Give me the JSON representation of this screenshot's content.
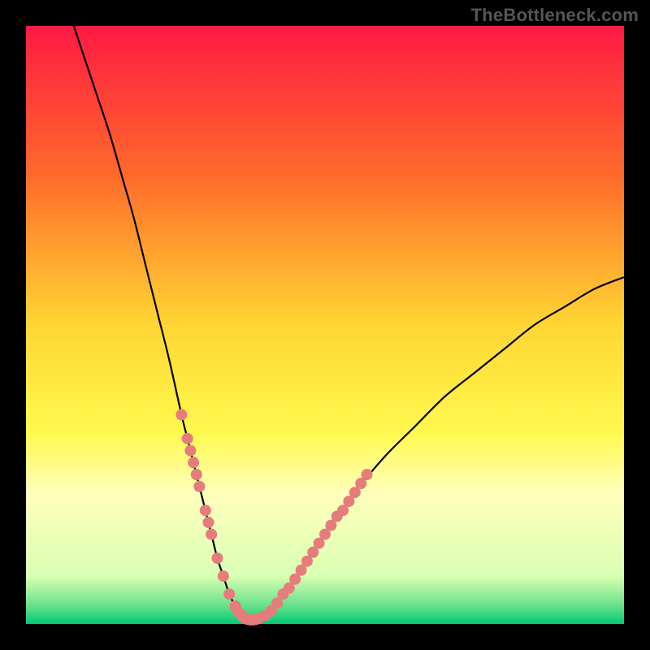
{
  "watermark": "TheBottleneck.com",
  "colors": {
    "frame": "#000000",
    "curve": "#000000",
    "marker": "#e77c7c"
  },
  "chart_data": {
    "type": "line",
    "title": "",
    "xlabel": "",
    "ylabel": "",
    "xlim": [
      0,
      100
    ],
    "ylim": [
      0,
      100
    ],
    "gradient": [
      {
        "stop": 0,
        "color": "#ff1a44"
      },
      {
        "stop": 0.25,
        "color": "#ff6a2a"
      },
      {
        "stop": 0.5,
        "color": "#ffd633"
      },
      {
        "stop": 0.68,
        "color": "#fff94d"
      },
      {
        "stop": 0.78,
        "color": "#ffffbb"
      },
      {
        "stop": 0.92,
        "color": "#d9ffb3"
      },
      {
        "stop": 0.97,
        "color": "#66e08c"
      },
      {
        "stop": 1.0,
        "color": "#00c977"
      }
    ],
    "series": [
      {
        "name": "bottleneck-curve",
        "x": [
          8,
          10,
          12,
          14,
          16,
          18,
          20,
          22,
          24,
          26,
          27,
          28,
          29,
          30,
          31,
          32,
          33,
          34,
          35,
          36,
          37,
          38,
          40,
          42,
          44,
          46,
          48,
          50,
          55,
          60,
          65,
          70,
          75,
          80,
          85,
          90,
          95,
          100
        ],
        "y": [
          100,
          94,
          88,
          82,
          75,
          68,
          60,
          52,
          44,
          35,
          31,
          27,
          23,
          19,
          15,
          11,
          8,
          5,
          3,
          1.5,
          0.7,
          0.7,
          1.4,
          3.5,
          6,
          9,
          12,
          15,
          22,
          28,
          33,
          38,
          42,
          46,
          50,
          53,
          56,
          58
        ]
      }
    ],
    "markers": {
      "name": "highlighted-dots",
      "color": "#e77c7c",
      "radius": 7,
      "points": [
        {
          "x": 26,
          "y": 35
        },
        {
          "x": 27,
          "y": 31
        },
        {
          "x": 27.5,
          "y": 29
        },
        {
          "x": 28,
          "y": 27
        },
        {
          "x": 28.5,
          "y": 25
        },
        {
          "x": 29,
          "y": 23
        },
        {
          "x": 30,
          "y": 19
        },
        {
          "x": 30.5,
          "y": 17
        },
        {
          "x": 31,
          "y": 15
        },
        {
          "x": 32,
          "y": 11
        },
        {
          "x": 33,
          "y": 8
        },
        {
          "x": 34,
          "y": 5
        },
        {
          "x": 35,
          "y": 3
        },
        {
          "x": 35.5,
          "y": 2
        },
        {
          "x": 36,
          "y": 1.5
        },
        {
          "x": 36.5,
          "y": 1
        },
        {
          "x": 37,
          "y": 0.8
        },
        {
          "x": 37.5,
          "y": 0.7
        },
        {
          "x": 38,
          "y": 0.7
        },
        {
          "x": 38.5,
          "y": 0.8
        },
        {
          "x": 39,
          "y": 1
        },
        {
          "x": 40,
          "y": 1.4
        },
        {
          "x": 41,
          "y": 2.2
        },
        {
          "x": 42,
          "y": 3.5
        },
        {
          "x": 43,
          "y": 5
        },
        {
          "x": 44,
          "y": 6
        },
        {
          "x": 45,
          "y": 7.5
        },
        {
          "x": 46,
          "y": 9
        },
        {
          "x": 47,
          "y": 10.5
        },
        {
          "x": 48,
          "y": 12
        },
        {
          "x": 49,
          "y": 13.5
        },
        {
          "x": 50,
          "y": 15
        },
        {
          "x": 51,
          "y": 16.5
        },
        {
          "x": 52,
          "y": 18
        },
        {
          "x": 53,
          "y": 19
        },
        {
          "x": 54,
          "y": 20.5
        },
        {
          "x": 55,
          "y": 22
        },
        {
          "x": 56,
          "y": 23.5
        },
        {
          "x": 57,
          "y": 25
        }
      ]
    }
  }
}
